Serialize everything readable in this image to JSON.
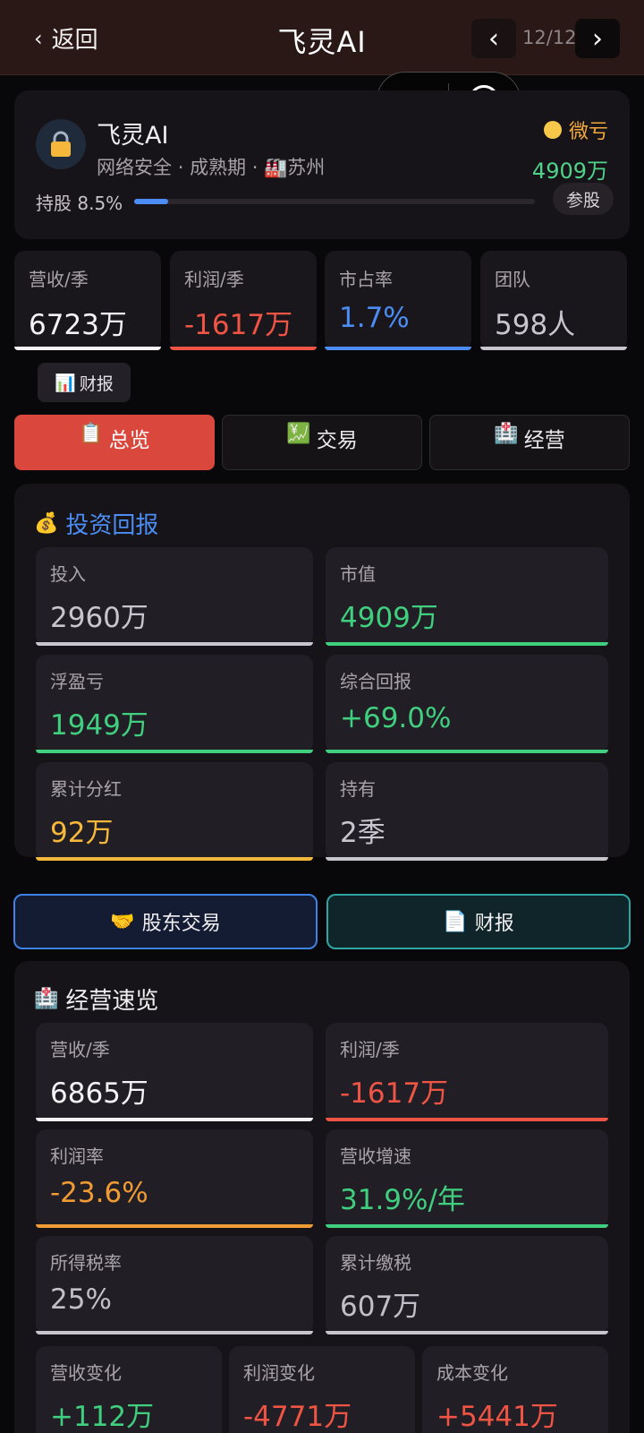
{
  "header": {
    "back_label": "返回",
    "title": "飞灵AI",
    "prev": "‹",
    "next": "›",
    "page": "12/12"
  },
  "company": {
    "name": "飞灵AI",
    "industry": "网络安全",
    "stage": "成熟期",
    "city": "苏州",
    "sep": "·",
    "status": "微亏",
    "market_value": "4909万",
    "holding_label": "持股 8.5%",
    "holding_fraction": 0.085,
    "join_label": "参股"
  },
  "kpis": [
    {
      "label": "营收/季",
      "value": "6723万",
      "color": "#f4f2f4"
    },
    {
      "label": "利润/季",
      "value": "-1617万",
      "color": "#ef5444"
    },
    {
      "label": "市占率",
      "value": "1.7%",
      "color": "#4b8df5"
    },
    {
      "label": "团队",
      "value": "598人",
      "color": "#c9c5cf"
    }
  ],
  "report_chip": {
    "icon": "📊",
    "label": "财报"
  },
  "tabs": [
    {
      "icon": "📋",
      "label": "总览"
    },
    {
      "icon": "💹",
      "label": "交易"
    },
    {
      "icon": "🏥",
      "label": "经营"
    }
  ],
  "investment": {
    "icon": "💰",
    "title": "投资回报",
    "tiles": [
      {
        "label": "投入",
        "value": "2960万"
      },
      {
        "label": "市值",
        "value": "4909万"
      },
      {
        "label": "浮盈亏",
        "value": "1949万"
      },
      {
        "label": "综合回报",
        "value": "+69.0%"
      },
      {
        "label": "累计分红",
        "value": "92万"
      },
      {
        "label": "持有",
        "value": "2季"
      }
    ]
  },
  "actions": {
    "trade": {
      "icon": "🤝",
      "label": "股东交易"
    },
    "report": {
      "icon": "📄",
      "label": "财报"
    }
  },
  "operations": {
    "icon": "🏥",
    "title": "经营速览",
    "tiles": [
      {
        "label": "营收/季",
        "value": "6865万"
      },
      {
        "label": "利润/季",
        "value": "-1617万"
      },
      {
        "label": "利润率",
        "value": "-23.6%"
      },
      {
        "label": "营收增速",
        "value": "31.9%/年"
      },
      {
        "label": "所得税率",
        "value": "25%"
      },
      {
        "label": "累计缴税",
        "value": "607万"
      }
    ],
    "changes": [
      {
        "label": "营收变化",
        "value": "+112万"
      },
      {
        "label": "利润变化",
        "value": "-4771万"
      },
      {
        "label": "成本变化",
        "value": "+5441万"
      }
    ]
  }
}
